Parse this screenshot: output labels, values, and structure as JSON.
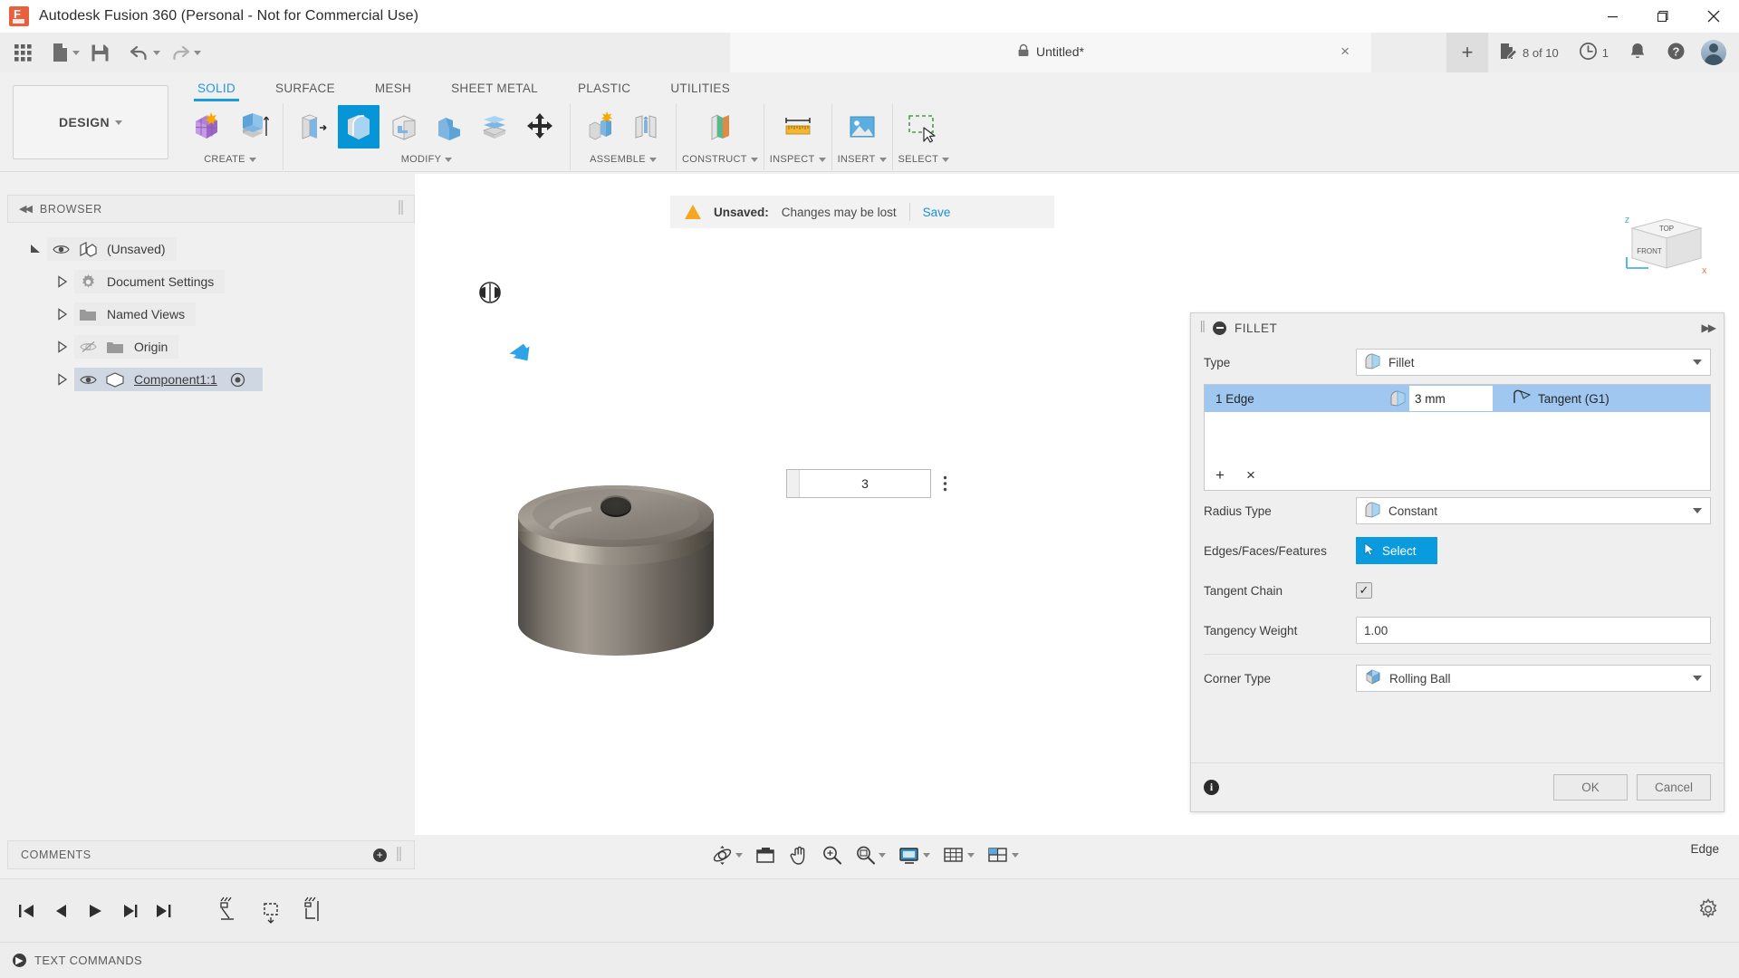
{
  "titlebar": {
    "app_title": "Autodesk Fusion 360 (Personal - Not for Commercial Use)",
    "logo_icon": "fusion-logo-icon",
    "minimize_icon": "minimize-icon",
    "maximize_icon": "maximize-icon",
    "close_icon": "close-icon"
  },
  "quick_access": {
    "grid_icon": "app-grid-icon",
    "new_icon": "new-document-icon",
    "save_icon": "save-icon",
    "undo_icon": "undo-icon",
    "redo_icon": "redo-icon",
    "document_tab": {
      "lock_icon": "lock-icon",
      "name": "Untitled*",
      "close_label": "×"
    },
    "new_tab_label": "+",
    "jobs": {
      "icon": "job-status-icon",
      "label": "8 of 10"
    },
    "history": {
      "icon": "clock-icon",
      "label": "1"
    },
    "notifications_icon": "bell-icon",
    "help_icon": "help-icon",
    "avatar_icon": "user-avatar"
  },
  "ribbon": {
    "workspace_label": "DESIGN",
    "tabs": [
      {
        "label": "SOLID",
        "active": true
      },
      {
        "label": "SURFACE",
        "active": false
      },
      {
        "label": "MESH",
        "active": false
      },
      {
        "label": "SHEET METAL",
        "active": false
      },
      {
        "label": "PLASTIC",
        "active": false
      },
      {
        "label": "UTILITIES",
        "active": false
      }
    ],
    "groups": [
      {
        "label": "CREATE",
        "has_caret": true
      },
      {
        "label": "MODIFY",
        "has_caret": true
      },
      {
        "label": "ASSEMBLE",
        "has_caret": true
      },
      {
        "label": "CONSTRUCT",
        "has_caret": true
      },
      {
        "label": "INSPECT",
        "has_caret": true
      },
      {
        "label": "INSERT",
        "has_caret": true
      },
      {
        "label": "SELECT",
        "has_caret": true
      }
    ]
  },
  "browser": {
    "title": "BROWSER",
    "collapse_icon": "collapse-left-icon",
    "items": [
      {
        "label": "(Unsaved)",
        "indent": 0,
        "expanded": true,
        "eye": "visible",
        "icon": "assembly-icon",
        "highlight": false
      },
      {
        "label": "Document Settings",
        "indent": 1,
        "expanded": false,
        "eye": "none",
        "icon": "gear-icon",
        "highlight": false
      },
      {
        "label": "Named Views",
        "indent": 1,
        "expanded": false,
        "eye": "none",
        "icon": "folder-icon",
        "highlight": false
      },
      {
        "label": "Origin",
        "indent": 1,
        "expanded": false,
        "eye": "hidden",
        "icon": "folder-icon",
        "highlight": false
      },
      {
        "label": "Component1:1",
        "indent": 1,
        "expanded": false,
        "eye": "visible",
        "icon": "component-icon",
        "highlight": true
      }
    ]
  },
  "canvas": {
    "unsaved_bar": {
      "warning_icon": "warning-triangle-icon",
      "title": "Unsaved:",
      "message": "Changes may be lost",
      "save_label": "Save"
    },
    "viewcube": {
      "top_label": "TOP",
      "front_label": "FRONT",
      "z_label": "Z",
      "x_label": "X"
    },
    "dimension_value": "3",
    "dimension_menu_icon": "more-options-icon",
    "manipulator_icon": "fillet-manipulator-icon",
    "arrow_icon": "drag-arrow-icon"
  },
  "fillet_dialog": {
    "title": "FILLET",
    "minimize_icon": "minus-circle-icon",
    "expand_icon": "expand-right-icon",
    "type_label": "Type",
    "type_value": "Fillet",
    "type_icon": "fillet-icon",
    "selection": {
      "name": "1 Edge",
      "icon": "fillet-icon",
      "radius": "3 mm",
      "continuity_icon": "tangent-icon",
      "continuity": "Tangent (G1)",
      "add_label": "+",
      "remove_label": "×"
    },
    "radius_type_label": "Radius Type",
    "radius_type_value": "Constant",
    "radius_type_icon": "fillet-icon",
    "edges_label": "Edges/Faces/Features",
    "select_button": "Select",
    "select_icon": "cursor-icon",
    "tangent_chain_label": "Tangent Chain",
    "tangent_chain_checked": "✓",
    "tangency_weight_label": "Tangency Weight",
    "tangency_weight_value": "1.00",
    "corner_type_label": "Corner Type",
    "corner_type_value": "Rolling Ball",
    "corner_type_icon": "rolling-ball-icon",
    "info_icon": "info-icon",
    "ok_label": "OK",
    "cancel_label": "Cancel"
  },
  "comments": {
    "title": "COMMENTS",
    "add_icon": "add-comment-icon"
  },
  "nav_toolbar": {
    "orbit_icon": "orbit-icon",
    "look_at_icon": "look-at-icon",
    "pan_icon": "pan-icon",
    "zoom_icon": "zoom-icon",
    "fit_icon": "fit-icon",
    "display_icon": "display-settings-icon",
    "grid_icon": "grid-snap-icon",
    "viewports_icon": "viewports-icon"
  },
  "status_bar": {
    "icon": "text-commands-icon",
    "label": "TEXT COMMANDS",
    "selection_label": "Edge"
  },
  "timeline": {
    "first_icon": "skip-first-icon",
    "prev_icon": "step-back-icon",
    "play_icon": "play-icon",
    "next_icon": "step-forward-icon",
    "last_icon": "skip-last-icon",
    "features": [
      "sketch-feature",
      "extrude-feature",
      "fillet-feature"
    ],
    "settings_icon": "gear-icon"
  },
  "colors": {
    "accent_blue": "#0a9bde",
    "tab_active": "#1a9bdc",
    "selection_blue": "#9fc7f0",
    "warning_orange": "#f5a623",
    "link_blue": "#1a8fd4"
  }
}
